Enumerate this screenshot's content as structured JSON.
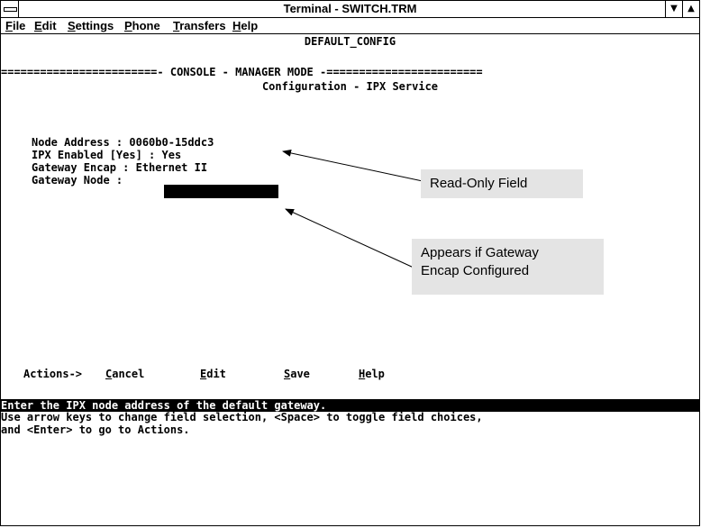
{
  "window": {
    "title": "Terminal - SWITCH.TRM",
    "minimize_glyph": "▼",
    "maximize_glyph": "▲"
  },
  "menu": [
    {
      "accel": "F",
      "rest": "ile"
    },
    {
      "accel": "E",
      "rest": "dit"
    },
    {
      "accel": "S",
      "rest": "ettings"
    },
    {
      "accel": "P",
      "rest": "hone"
    },
    {
      "accel": "T",
      "rest": "ransfers"
    },
    {
      "accel": "H",
      "rest": "elp"
    }
  ],
  "terminal": {
    "config_name": "DEFAULT_CONFIG",
    "mode_banner": "========================- CONSOLE - MANAGER MODE -========================",
    "screen_title": "Configuration - IPX Service",
    "fields": {
      "node_address": "Node Address : 0060b0-15ddc3",
      "ipx_enabled": "IPX Enabled [Yes] : Yes",
      "gateway_encap": "Gateway Encap : Ethernet II",
      "gateway_node": "Gateway Node : "
    },
    "actions_label": "Actions->",
    "actions": [
      {
        "accel": "C",
        "rest": "ancel"
      },
      {
        "accel": "E",
        "rest": "dit"
      },
      {
        "accel": "S",
        "rest": "ave"
      },
      {
        "accel": "H",
        "rest": "elp"
      }
    ],
    "help_highlight": "Enter the IPX node address of the default gateway.",
    "help_line1": "Use arrow keys to change field selection, <Space> to toggle field choices,",
    "help_line2": "and <Enter> to go to Actions."
  },
  "callouts": {
    "read_only": "Read-Only Field",
    "gateway_line1": "Appears if Gateway",
    "gateway_line2": "Encap Configured"
  }
}
